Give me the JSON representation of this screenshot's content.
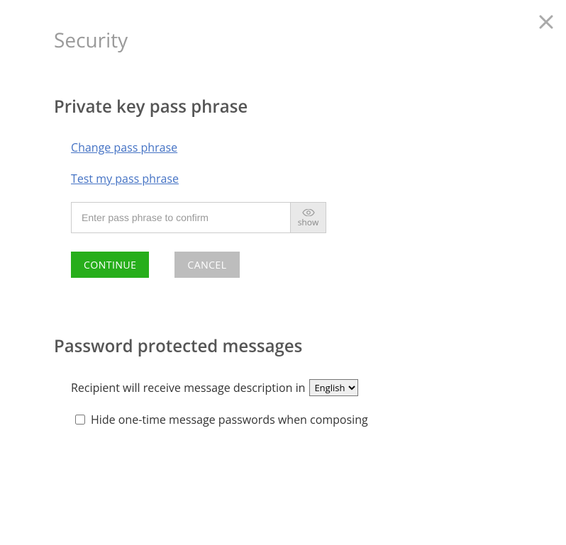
{
  "page": {
    "title": "Security"
  },
  "sections": {
    "passphrase": {
      "heading": "Private key pass phrase",
      "change_link": "Change pass phrase",
      "test_link": "Test my pass phrase",
      "input_placeholder": "Enter pass phrase to confirm",
      "show_toggle_label": "show",
      "continue_label": "CONTINUE",
      "cancel_label": "CANCEL"
    },
    "pwd_protected": {
      "heading": "Password protected messages",
      "lang_label": "Recipient will receive message description in",
      "lang_selected": "English",
      "hide_passwords_label": "Hide one-time message passwords when composing",
      "hide_passwords_checked": false
    }
  }
}
